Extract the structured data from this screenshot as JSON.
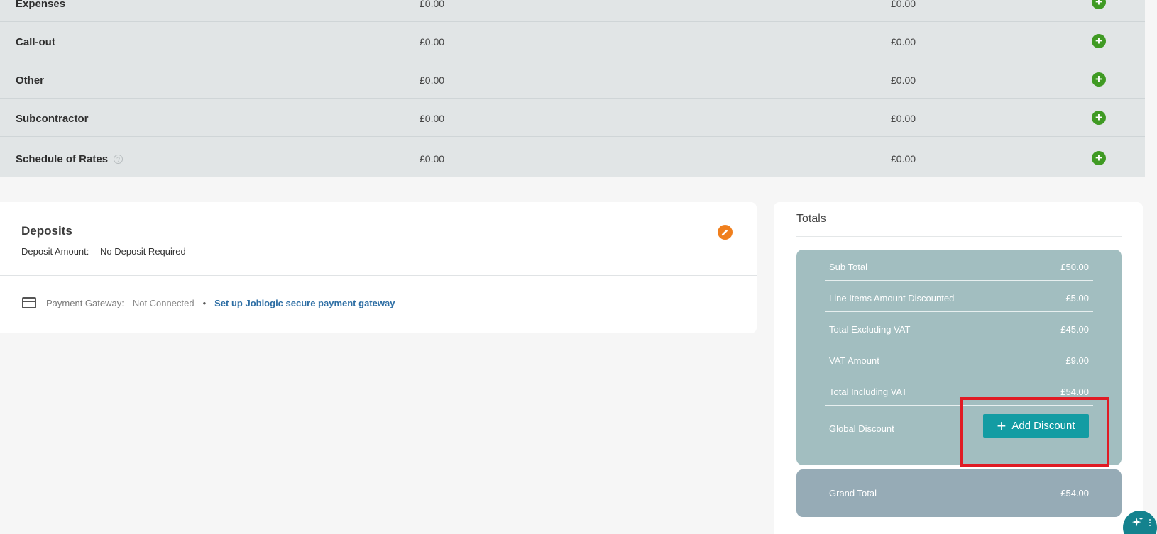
{
  "cost_rows": [
    {
      "label": "Expenses",
      "value1": "£0.00",
      "value2": "£0.00"
    },
    {
      "label": "Call-out",
      "value1": "£0.00",
      "value2": "£0.00"
    },
    {
      "label": "Other",
      "value1": "£0.00",
      "value2": "£0.00"
    },
    {
      "label": "Subcontractor",
      "value1": "£0.00",
      "value2": "£0.00"
    },
    {
      "label": "Schedule of Rates",
      "value1": "£0.00",
      "value2": "£0.00"
    }
  ],
  "deposits": {
    "title": "Deposits",
    "amount_label": "Deposit Amount:",
    "amount_value": "No Deposit Required",
    "gateway_label": "Payment Gateway:",
    "gateway_status": "Not Connected",
    "separator": "•",
    "gateway_link": "Set up Joblogic secure payment gateway"
  },
  "totals": {
    "title": "Totals",
    "rows": [
      {
        "label": "Sub Total",
        "value": "£50.00"
      },
      {
        "label": "Line Items Amount Discounted",
        "value": "£5.00"
      },
      {
        "label": "Total Excluding VAT",
        "value": "£45.00"
      },
      {
        "label": "VAT Amount",
        "value": "£9.00"
      },
      {
        "label": "Total Including VAT",
        "value": "£54.00"
      }
    ],
    "global_discount_label": "Global Discount",
    "add_discount_label": "Add Discount",
    "grand_total_label": "Grand Total",
    "grand_total_value": "£54.00"
  },
  "icons": {
    "add": "plus-circle-icon",
    "edit": "pencil-icon",
    "card": "credit-card-icon",
    "help": "question-circle-icon",
    "assistant": "sparkle-icon"
  },
  "colors": {
    "add_green": "#3f9a23",
    "edit_orange": "#f07f1d",
    "teal_button": "#139ca3",
    "highlight_red": "#e01b24"
  }
}
